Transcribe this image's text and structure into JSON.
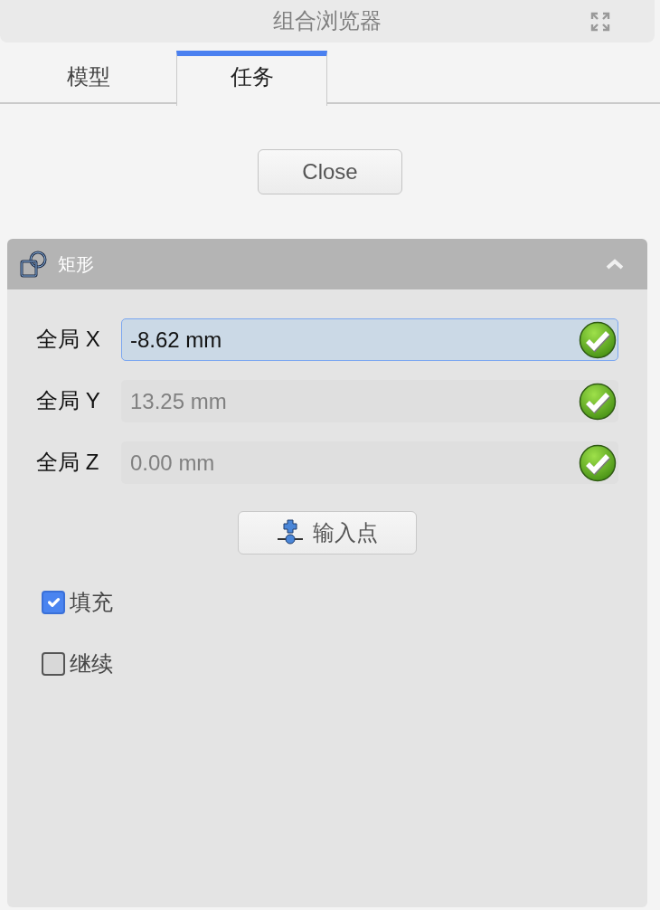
{
  "window": {
    "title": "组合浏览器"
  },
  "tabs": [
    {
      "label": "模型",
      "selected": false
    },
    {
      "label": "任务",
      "selected": true
    }
  ],
  "close_button": {
    "label": "Close"
  },
  "panel": {
    "title": "矩形",
    "expanded": true,
    "fields": [
      {
        "label": "全局 X",
        "value": "-8.62 mm",
        "selected": true
      },
      {
        "label": "全局 Y",
        "value": "13.25 mm",
        "selected": false
      },
      {
        "label": "全局 Z",
        "value": "0.00 mm",
        "selected": false
      }
    ],
    "input_point_button": {
      "label": "输入点"
    },
    "checkboxes": [
      {
        "label": "填充",
        "checked": true
      },
      {
        "label": "继续",
        "checked": false
      }
    ]
  }
}
